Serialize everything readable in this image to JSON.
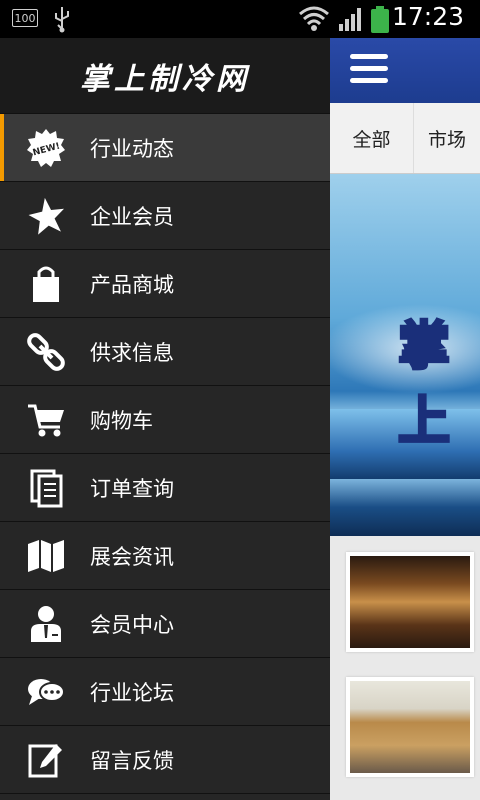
{
  "status_bar": {
    "battery_percent_label": "100",
    "time": "17:23",
    "battery_color": "#3cb34a"
  },
  "drawer": {
    "title": "掌上制冷网",
    "active_accent": "#f39a00",
    "items": [
      {
        "label": "行业动态",
        "icon": "new-badge-icon"
      },
      {
        "label": "企业会员",
        "icon": "star-icon"
      },
      {
        "label": "产品商城",
        "icon": "shopping-bag-icon"
      },
      {
        "label": "供求信息",
        "icon": "link-chain-icon"
      },
      {
        "label": "购物车",
        "icon": "shopping-cart-icon"
      },
      {
        "label": "订单查询",
        "icon": "documents-icon"
      },
      {
        "label": "展会资讯",
        "icon": "map-icon"
      },
      {
        "label": "会员中心",
        "icon": "member-person-icon"
      },
      {
        "label": "行业论坛",
        "icon": "chat-bubbles-icon"
      },
      {
        "label": "留言反馈",
        "icon": "edit-note-icon"
      }
    ]
  },
  "content": {
    "header_color": "#1d3c8f",
    "tabs": [
      "全部",
      "市场"
    ],
    "banner_text": "掌上"
  }
}
